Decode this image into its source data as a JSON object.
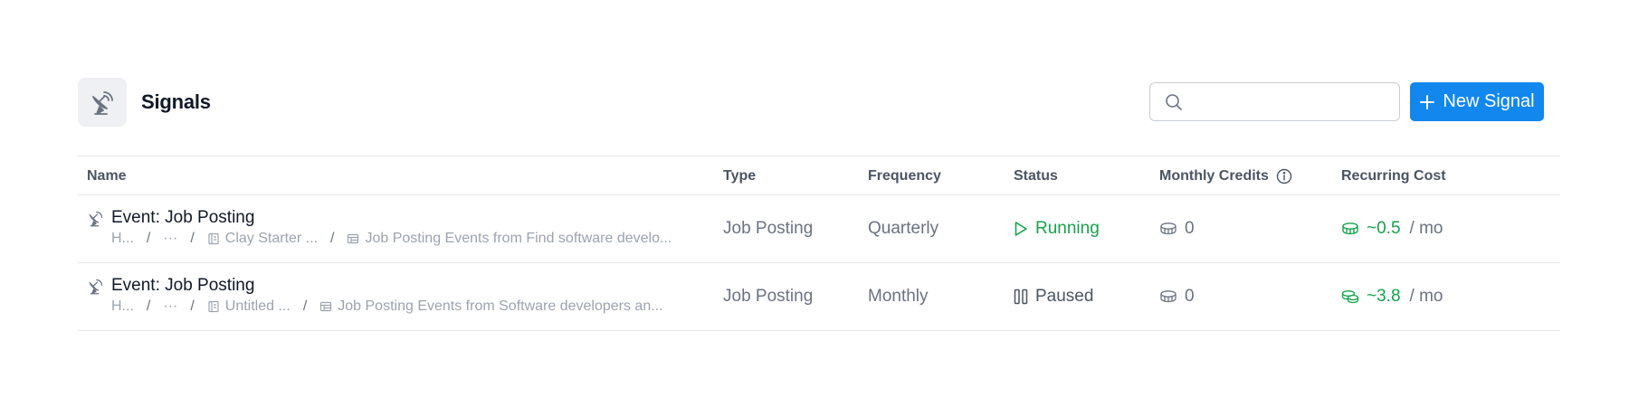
{
  "header": {
    "title": "Signals",
    "search_placeholder": "",
    "new_button_label": "New Signal"
  },
  "table": {
    "columns": {
      "name": "Name",
      "type": "Type",
      "frequency": "Frequency",
      "status": "Status",
      "credits": "Monthly Credits",
      "cost": "Recurring Cost"
    },
    "rows": [
      {
        "name": "Event: Job Posting",
        "path": [
          "H...",
          "···",
          "Clay Starter ...",
          "Job Posting Events from Find software develo..."
        ],
        "type": "Job Posting",
        "frequency": "Quarterly",
        "status": "Running",
        "credits": "0",
        "cost": "~0.5",
        "cost_unit": "/ mo"
      },
      {
        "name": "Event: Job Posting",
        "path": [
          "H...",
          "···",
          "Untitled ...",
          "Job Posting Events from Software developers an..."
        ],
        "type": "Job Posting",
        "frequency": "Monthly",
        "status": "Paused",
        "credits": "0",
        "cost": "~3.8",
        "cost_unit": "/ mo"
      }
    ]
  },
  "colors": {
    "accent": "#1287ee",
    "running": "#16a34a",
    "icon_bg": "#eef0f3"
  }
}
